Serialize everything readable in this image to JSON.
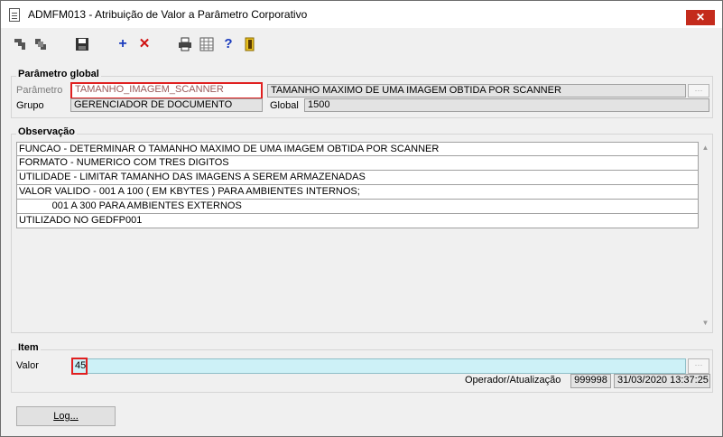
{
  "window": {
    "title": "ADMFM013 - Atribuição de Valor a Parâmetro Corporativo",
    "close_label": "✕"
  },
  "toolbar": {
    "icons": [
      "first-record-icon",
      "previous-record-icon",
      "save-icon",
      "add-icon",
      "delete-icon",
      "print-icon",
      "grid-icon",
      "help-icon",
      "exit-icon"
    ]
  },
  "parametro_global": {
    "title": "Parâmetro global",
    "parametro_label": "Parâmetro",
    "parametro_value": "TAMANHO_IMAGEM_SCANNER",
    "descricao_value": "TAMANHO MAXIMO DE UMA IMAGEM OBTIDA POR SCANNER",
    "grupo_label": "Grupo",
    "grupo_value": "GERENCIADOR DE DOCUMENTO",
    "global_label": "Global",
    "global_value": "1500",
    "lookup_label": "⋯"
  },
  "observacao": {
    "title": "Observação",
    "lines": [
      "FUNCAO - DETERMINAR O TAMANHO MAXIMO DE UMA IMAGEM OBTIDA POR SCANNER",
      "FORMATO - NUMERICO COM TRES DIGITOS",
      "UTILIDADE - LIMITAR TAMANHO DAS IMAGENS A SEREM ARMAZENADAS",
      "VALOR VALIDO - 001 A 100 ( EM KBYTES ) PARA AMBIENTES INTERNOS;",
      "            001 A 300 PARA AMBIENTES EXTERNOS",
      "UTILIZADO NO GEDFP001"
    ]
  },
  "item": {
    "title": "Item",
    "valor_label": "Valor",
    "valor_value": "45",
    "operador_label": "Operador/Atualização",
    "operador_value": "999998",
    "atualizacao_value": "31/03/2020 13:37:25",
    "lookup_label": "⋯"
  },
  "log_button": {
    "label": "Log..."
  }
}
